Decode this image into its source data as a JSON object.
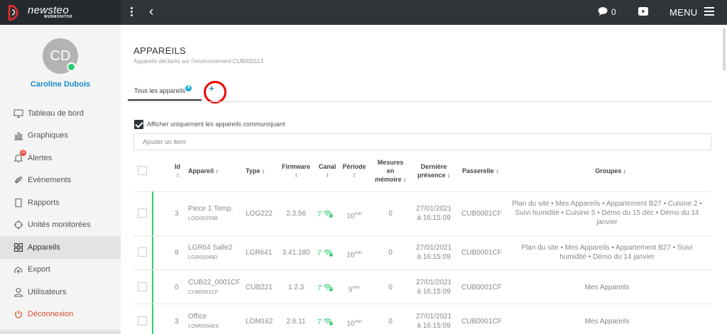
{
  "app": {
    "logo_text": "newsteo",
    "logo_sub": "WEBMONITOR"
  },
  "topbar": {
    "chat_count": "0",
    "menu_label": "MENU"
  },
  "user": {
    "initials": "CD",
    "name": "Caroline Dubois"
  },
  "sidebar": {
    "items": [
      {
        "label": "Tableau de bord",
        "icon": "monitor-icon"
      },
      {
        "label": "Graphiques",
        "icon": "bar-chart-icon"
      },
      {
        "label": "Alertes",
        "icon": "bell-icon",
        "badge": "11"
      },
      {
        "label": "Evènements",
        "icon": "paperclip-icon"
      },
      {
        "label": "Rapports",
        "icon": "document-icon"
      },
      {
        "label": "Unités monitorées",
        "icon": "crosshair-icon"
      },
      {
        "label": "Appareils",
        "icon": "grid-icon",
        "active": true
      },
      {
        "label": "Export",
        "icon": "cloud-upload-icon"
      },
      {
        "label": "Utilisateurs",
        "icon": "user-icon"
      },
      {
        "label": "Déconnexion",
        "icon": "power-icon"
      }
    ]
  },
  "main": {
    "title": "APPAREILS",
    "subtitle": "Appareils déclarés sur l'environnement CUB000113",
    "tabs": [
      {
        "label": "Tous les appareils",
        "count": "9"
      }
    ],
    "add_tab_label": "+",
    "filter_label": "Afficher uniquement les appareils communiquant",
    "add_item_placeholder": "Ajouter un item"
  },
  "table": {
    "headers": {
      "id": "Id",
      "device": "Appareil",
      "type": "Type",
      "firmware": "Firmware",
      "canal": "Canal",
      "period": "Période",
      "memory_1": "Mesures",
      "memory_2": "en",
      "memory_3": "mémoire",
      "presence_1": "Dernière",
      "presence_2": "présence",
      "gateway": "Passerelle",
      "groups": "Groupes"
    },
    "rows": [
      {
        "id": "3",
        "name": "Piece 1 Temp.",
        "ref": "LOG00255B",
        "type": "LOG222",
        "firmware": "2.3.56",
        "canal": "7",
        "period": "10",
        "period_unit": "min",
        "memory": "0",
        "date": "27/01/2021",
        "time": "à 16:15:09",
        "gateway": "CUB0001CF",
        "groups_1": "Plan du site • Mes Appareils • Appartement B27 • Cuisine 2 •",
        "groups_2": "Suivi humidité • Cuisine 5 • Démo du 15 déc • Démo du 14",
        "groups_3": "janvier"
      },
      {
        "id": "9",
        "name": "LGR64 Salle2",
        "ref": "LGR00248D",
        "type": "LGR641",
        "firmware": "3.41.180",
        "canal": "7",
        "period": "10",
        "period_unit": "min",
        "memory": "0",
        "date": "27/01/2021",
        "time": "à 16:15:09",
        "gateway": "CUB0001CF",
        "groups_1": "Plan du site • Mes Appareils • Appartement B27 • Suivi",
        "groups_2": "humidité • Démo du 14 janvier",
        "groups_3": ""
      },
      {
        "id": "0",
        "name": "CUB22_0001CF",
        "ref": "CUB0001CF",
        "type": "CUB221",
        "firmware": "1.2.3",
        "canal": "7",
        "period": "5",
        "period_unit": "min",
        "memory": "0",
        "date": "27/01/2021",
        "time": "à 16:15:09",
        "gateway": "CUB0001CF",
        "groups_1": "Mes Appareils",
        "groups_2": "",
        "groups_3": ""
      },
      {
        "id": "3",
        "name": "Office",
        "ref": "LOM000AE6",
        "type": "LOM162",
        "firmware": "2.6.11",
        "canal": "7",
        "period": "10",
        "period_unit": "min",
        "memory": "0",
        "date": "27/01/2021",
        "time": "à 16:15:09",
        "gateway": "CUB0001CF",
        "groups_1": "Mes Appareils",
        "groups_2": "",
        "groups_3": ""
      }
    ]
  }
}
